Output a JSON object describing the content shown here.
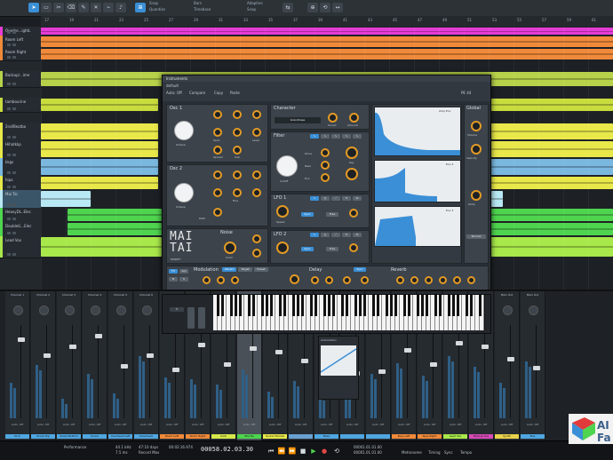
{
  "toolbar": {
    "items": [
      "Snap",
      "Quantize",
      "Timebase",
      "Adaptive",
      "Snap"
    ],
    "left_tool": "◆"
  },
  "ruler": {
    "marks": [
      "17",
      "19",
      "21",
      "23",
      "25",
      "27",
      "29",
      "31",
      "33",
      "35",
      "37",
      "39",
      "41",
      "43",
      "45",
      "47",
      "49",
      "51",
      "53",
      "55",
      "57",
      "59",
      "61"
    ]
  },
  "tracks": [
    {
      "name": "Overhe...ightL",
      "color": "#e63bd6"
    },
    {
      "name": "Room Left",
      "color": "#f08a3a"
    },
    {
      "name": "Room Right",
      "color": "#f08a3a"
    },
    {
      "name": "Backup/...ime",
      "color": "#b7d24a"
    },
    {
      "name": "tambourine",
      "color": "#c8dc3e"
    },
    {
      "name": "2nd/Beatbo",
      "color": "#e8e84a"
    },
    {
      "name": "Hihatkkp",
      "color": "#e8e84a"
    },
    {
      "name": "kkgs",
      "color": "#7ab8e0"
    },
    {
      "name": "hipo",
      "color": "#e8e84a"
    },
    {
      "name": "Mai Tai",
      "color": "#b8e8f4"
    },
    {
      "name": "HeavyDL..Elec",
      "color": "#4fd44f"
    },
    {
      "name": "DoubleG...Elec",
      "color": "#4fd44f"
    },
    {
      "name": "Lead Vox",
      "color": "#a8e84a"
    }
  ],
  "instrument": {
    "title": "Instruments",
    "preset": "default",
    "header": [
      "Auto: Off",
      "Compare",
      "Copy",
      "Paste"
    ],
    "cpu": "PE 44",
    "osc1": "Osc 1",
    "osc2": "Osc 2",
    "octave": "Octave",
    "pitch": "Pitch",
    "semi": "Semi",
    "fine": "Fine",
    "level": "Level",
    "spread": "Spread",
    "sub": "Sub",
    "character": "Character",
    "character_type": "GrandCase",
    "sound": "Sound",
    "amount": "Amount",
    "filter": "Filter",
    "drive": "Drive",
    "cutoff": "Cutoff",
    "reso": "Reso",
    "env": "Env",
    "key": "Key",
    "lfo1": "LFO 1",
    "lfo2": "LFO 2",
    "speed": "Speed",
    "sync": "Sync",
    "free": "Free",
    "noise": "Noise",
    "color": "Color",
    "global": "Global",
    "volume": "Volume",
    "velocity": "Velocity",
    "amp_env": "Amp Env",
    "env2": "Env 2",
    "env3": "Env 3",
    "modulation": "Modulation",
    "mod_items": [
      "Vibrato",
      "Target",
      "Preset"
    ],
    "delay": "Delay",
    "reverb": "Reverb",
    "logo": "MAI TAI",
    "modify": "MODIFY",
    "normal": "Normal",
    "glide": "Glide"
  },
  "mixer": {
    "strips": [
      {
        "name": "Channel 1",
        "bar": "Kick",
        "color": "#4fa6e0"
      },
      {
        "name": "Channel 2",
        "bar": "Snare Top",
        "color": "#4fa6e0"
      },
      {
        "name": "Channel 3",
        "bar": "Snare Bottom",
        "color": "#4fa6e0"
      },
      {
        "name": "Channel 4",
        "bar": "Snare",
        "color": "#4fa6e0"
      },
      {
        "name": "Channel 5",
        "bar": "Overhead Left",
        "color": "#4fa6e0"
      },
      {
        "name": "Channel 6",
        "bar": "Overhead",
        "color": "#4fa6e0"
      },
      {
        "name": "Channel 7",
        "bar": "Room Left",
        "color": "#f08a3a"
      },
      {
        "name": "Channel 8",
        "bar": "Room Right",
        "color": "#f08a3a"
      },
      {
        "name": "Channel 9",
        "bar": "Amb",
        "color": "#d6e84a"
      },
      {
        "name": "Channel 10",
        "bar": "Mai Tai",
        "color": "#4fd44f"
      },
      {
        "name": "Channel 11",
        "bar": "Sound Module",
        "color": "#e8e84a"
      },
      {
        "name": "Channel 12",
        "bar": "",
        "color": "#6aa0d0"
      },
      {
        "name": "Channel 13",
        "bar": "Bass",
        "color": "#4fa6e0"
      },
      {
        "name": "Channel 14",
        "bar": "",
        "color": "#4fa6e0"
      },
      {
        "name": "Channel 15",
        "bar": "",
        "color": "#4fa6e0"
      },
      {
        "name": "Channel 16",
        "bar": "Keys Left",
        "color": "#f08a3a"
      },
      {
        "name": "Channel 17",
        "bar": "Keys Right",
        "color": "#f08a3a"
      },
      {
        "name": "Main Out",
        "bar": "Lead Vox",
        "color": "#a8e84a"
      },
      {
        "name": "Main Out",
        "bar": "Backup Vox",
        "color": "#d84ab8"
      },
      {
        "name": "Main Out",
        "bar": "Synth",
        "color": "#e8d24a"
      },
      {
        "name": "Main Out",
        "bar": "Bus",
        "color": "#4fa6e0"
      }
    ],
    "auto_label": "Auto: Off",
    "automation_title": "Automation"
  },
  "transport": {
    "sample_rate": "44.1 kHz",
    "latency": "7.5 ms",
    "record_time": "47:10 days",
    "record_label": "Record Max",
    "position": "00058.02.03.30",
    "time": "00:02:16.974",
    "loop_start": "00001.01.01.00",
    "loop_end": "00001.01.01.00",
    "metronome": "Metronome",
    "timing": "Timing",
    "tempo": "Tempo",
    "sync_label": "Sync",
    "perf": "Performance"
  },
  "watermark": {
    "text": "AI Fa"
  }
}
